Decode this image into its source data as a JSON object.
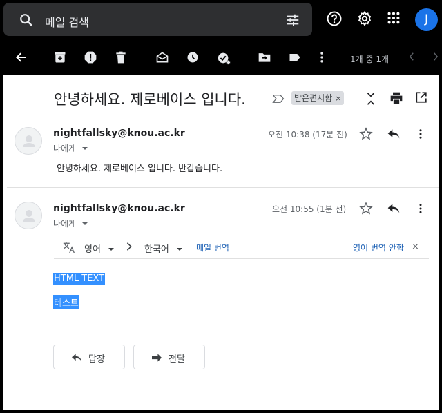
{
  "search": {
    "placeholder": "메일 검색",
    "avatar_letter": "J"
  },
  "toolbar": {
    "count": "1개 중 1개"
  },
  "thread": {
    "subject": "안녕하세요. 제로베이스 입니다.",
    "label": "받은편지함",
    "label_close": "×"
  },
  "messages": [
    {
      "sender": "nightfallsky@knou.ac.kr",
      "to": "나에게",
      "time": "오전 10:38 (17분 전)",
      "body": "안녕하세요. 제로베이스 입니다. 반갑습니다."
    },
    {
      "sender": "nightfallsky@knou.ac.kr",
      "to": "나에게",
      "time": "오전 10:55 (1분 전)",
      "body_lines": [
        "HTML TEXT",
        "테스트"
      ]
    }
  ],
  "translate": {
    "source_lang": "영어",
    "target_lang": "한국어",
    "translate_link": "메일 번역",
    "never_translate": "영어 번역 안함",
    "close": "×"
  },
  "actions": {
    "reply": "답장",
    "forward": "전달"
  },
  "colors": {
    "accent": "#1a73e8",
    "selection": "#3390ff"
  }
}
